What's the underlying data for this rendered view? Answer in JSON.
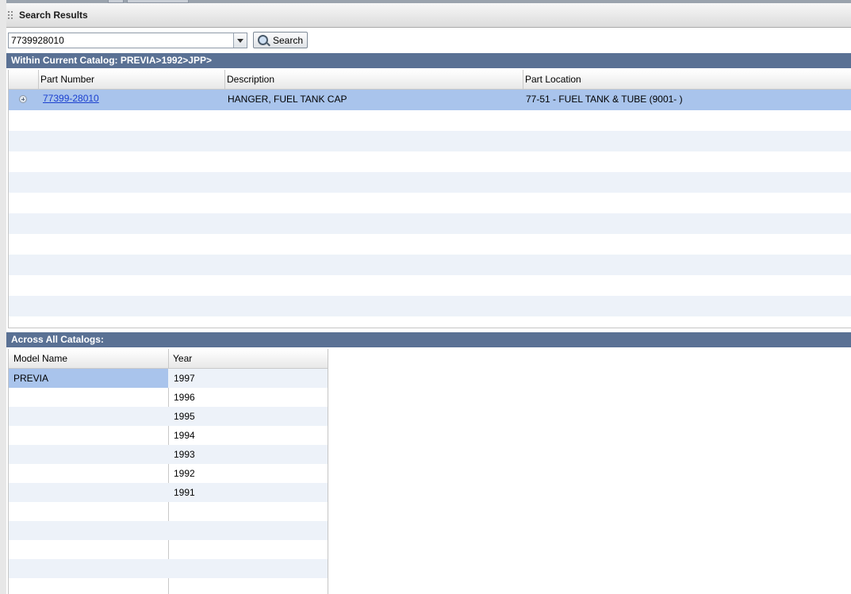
{
  "window": {
    "title": "Search Results"
  },
  "search": {
    "value": "7739928010",
    "button_label": "Search"
  },
  "current_catalog": {
    "heading": "Within Current Catalog: PREVIA>1992>JPP>",
    "columns": [
      "Part Number",
      "Description",
      "Part Location"
    ],
    "rows": [
      {
        "part_number": "77399-28010",
        "description": "HANGER, FUEL TANK CAP",
        "location": "77-51 - FUEL TANK & TUBE (9001- )"
      }
    ]
  },
  "all_catalogs": {
    "heading": "Across All Catalogs:",
    "columns": [
      "Model Name",
      "Year"
    ],
    "model": "PREVIA",
    "years": [
      "1997",
      "1996",
      "1995",
      "1994",
      "1993",
      "1992",
      "1991"
    ]
  },
  "colors": {
    "section_bar": "#5a7194",
    "selected_row": "#a9c4ec",
    "alt_row": "#edf2f9",
    "link": "#1a3fcf"
  }
}
